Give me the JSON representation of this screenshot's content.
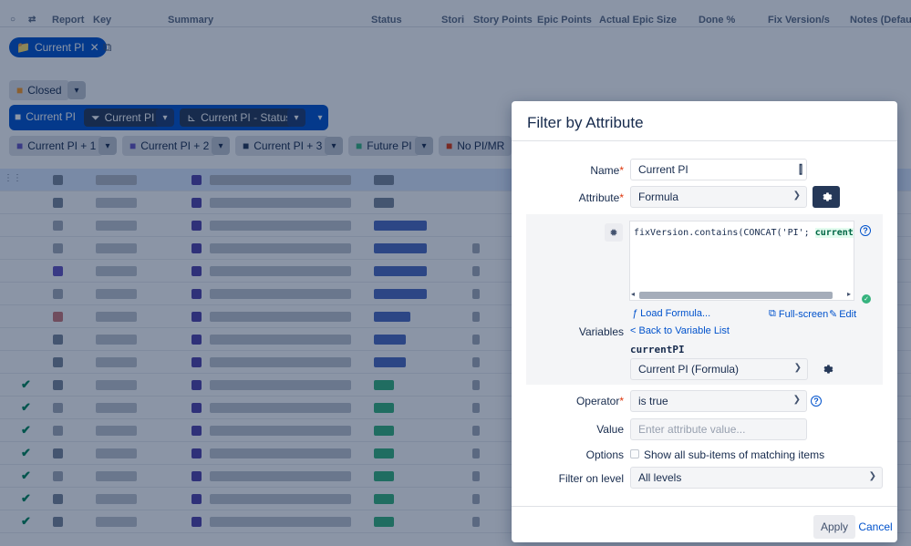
{
  "columns": [
    "Report",
    "Key",
    "Summary",
    "Status",
    "Stori",
    "Story Points",
    "Epic Points",
    "Actual Epic Size",
    "Done %",
    "Fix Version/s",
    "Notes (Default)"
  ],
  "filter_pills": {
    "current_pi": "Current PI",
    "closed": "Closed",
    "group_label": "Current PI",
    "sub_filter": "Current PI",
    "sub_status": "Current PI - Status",
    "pi_plus_1": "Current PI + 1",
    "pi_plus_2": "Current PI + 2",
    "pi_plus_3": "Current PI + 3",
    "future_pi": "Future PI",
    "no_pi": "No PI/MR"
  },
  "dialog": {
    "title": "Filter by Attribute",
    "name_label": "Name",
    "name_value": "Current PI",
    "attribute_label": "Attribute",
    "attribute_value": "Formula",
    "formula_prefix": "fixVersion.contains(CONCAT('PI'; ",
    "formula_var": "currentPI",
    "formula_suffix": ")",
    "load_formula": "Load Formula...",
    "full_screen": "Full-screen",
    "edit": "Edit",
    "variables_label": "Variables",
    "back_to_list": "< Back to Variable List",
    "variable_name": "currentPI",
    "variable_value": "Current PI (Formula)",
    "operator_label": "Operator",
    "operator_value": "is true",
    "value_label": "Value",
    "value_placeholder": "Enter attribute value...",
    "options_label": "Options",
    "options_checkbox": "Show all sub-items of matching items",
    "filter_level_label": "Filter on level",
    "filter_level_value": "All levels",
    "apply": "Apply",
    "cancel": "Cancel"
  }
}
